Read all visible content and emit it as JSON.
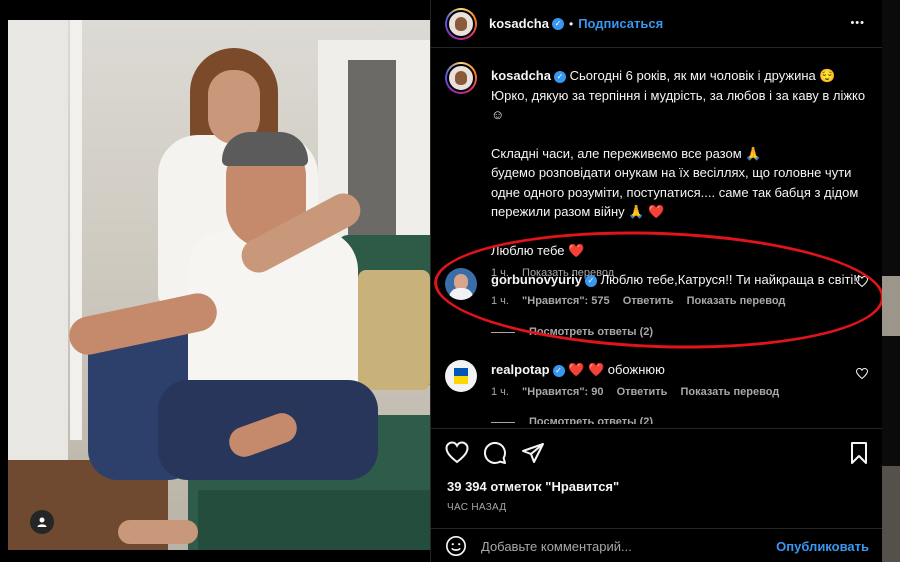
{
  "post": {
    "username": "kosadcha",
    "follow_label": "Подписаться",
    "separator": "•",
    "more_label": "•••",
    "caption": {
      "line1": "Сьогодні 6 років, як ми чоловік і дружина 😌",
      "line2": "Юрко, дякую за терпіння і мудрість, за любов і за каву в ліжко ☺",
      "line3": "Складні часи, але переживемо все разом 🙏",
      "line4": "будемо розповідати онукам на їх весіллях, що головне чути одне одного розуміти, поступатися.... саме так бабця з дідом пережили разом війну 🙏 ❤️",
      "line5": "Люблю тебе ❤️",
      "time": "1 ч.",
      "translate": "Показать перевод"
    }
  },
  "comments": [
    {
      "username": "gorbunovyuriy",
      "text": "Люблю тебе,Катруся!! Ти найкраща в світі!!",
      "time": "1 ч.",
      "likes": "\"Нравится\": 575",
      "reply": "Ответить",
      "translate": "Показать перевод",
      "view_replies": "Посмотреть ответы (2)"
    },
    {
      "username": "realpotap",
      "text": "❤️ ❤️ обожнюю",
      "time": "1 ч.",
      "likes": "\"Нравится\": 90",
      "reply": "Ответить",
      "translate": "Показать перевод",
      "view_replies": "Посмотреть ответы (2)"
    }
  ],
  "footer": {
    "likes_count": "39 394 отметок \"Нравится\"",
    "time_ago": "ЧАС НАЗАД",
    "comment_placeholder": "Добавьте комментарий...",
    "publish_label": "Опубликовать"
  },
  "colors": {
    "accent": "#3897f0",
    "annotation": "#e0141a",
    "background": "#000000",
    "heart": "#ed4956"
  }
}
